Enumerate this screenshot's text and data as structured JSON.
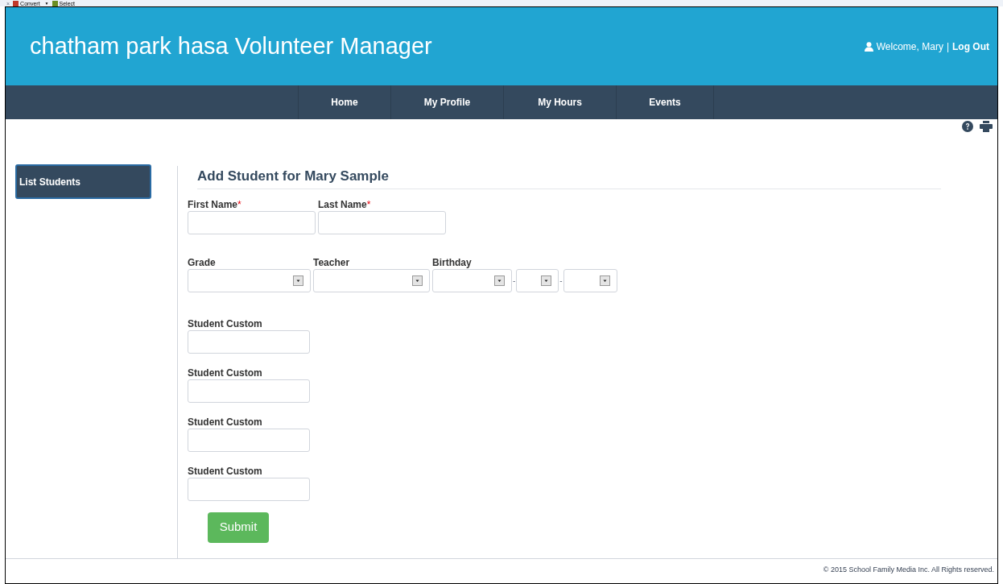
{
  "toolbar": {
    "close": "×",
    "items": [
      {
        "label": "Convert",
        "dropdown": "▼"
      },
      {
        "label": "Select"
      }
    ]
  },
  "header": {
    "title": "chatham park hasa Volunteer Manager",
    "welcome": "Welcome, Mary",
    "separator": "|",
    "logout": "Log Out"
  },
  "nav": [
    {
      "label": "Home"
    },
    {
      "label": "My Profile"
    },
    {
      "label": "My Hours"
    },
    {
      "label": "Events"
    }
  ],
  "sidebar": {
    "items": [
      {
        "label": "List Students",
        "selected": true
      }
    ]
  },
  "form": {
    "title": "Add Student for Mary Sample",
    "name_fields": [
      {
        "label": "First Name",
        "required_mark": "*"
      },
      {
        "label": "Last Name",
        "required_mark": "*"
      }
    ],
    "selects": [
      {
        "label": "Grade",
        "parts": [
          {
            "kind": "dropdown"
          }
        ]
      },
      {
        "label": "Teacher",
        "parts": [
          {
            "kind": "dropdown"
          }
        ]
      },
      {
        "label": "Birthday",
        "parts": [
          {
            "kind": "dropdown"
          },
          {
            "kind": "dropdown",
            "separator": "-"
          },
          {
            "kind": "dropdown",
            "separator": "-"
          }
        ]
      }
    ],
    "custom_fields": [
      {
        "label": "Student Custom"
      },
      {
        "label": "Student Custom"
      },
      {
        "label": "Student Custom"
      },
      {
        "label": "Student Custom"
      }
    ],
    "submit": "Submit"
  },
  "footer": "© 2015 School Family Media Inc. All Rights reserved."
}
